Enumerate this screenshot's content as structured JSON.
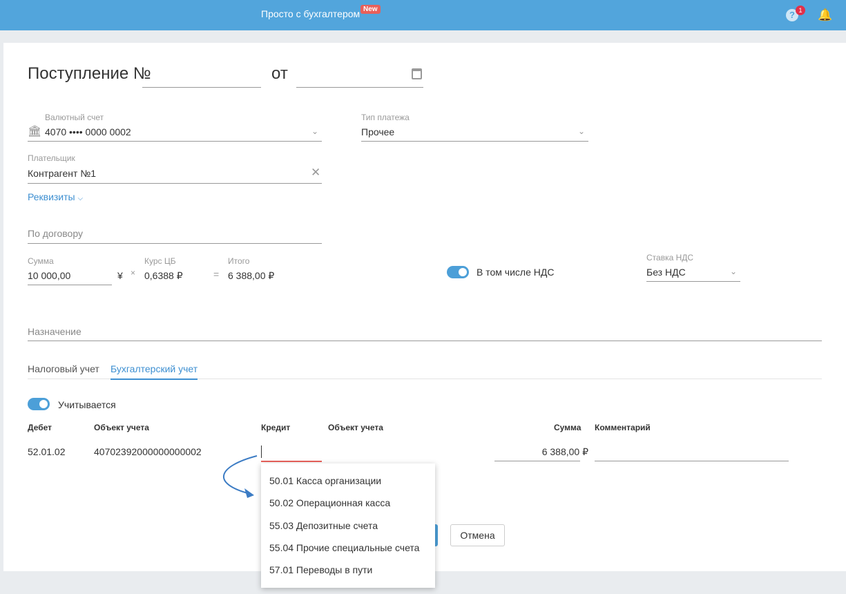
{
  "header": {
    "brand": "Просто с бухгалтером",
    "new_badge": "New",
    "help_count": "1"
  },
  "form": {
    "title": "Поступление №",
    "number_value": "",
    "from_label": "от",
    "date_value": "",
    "currency_account": {
      "label": "Валютный счет",
      "value": "4070 •••• 0000 0002"
    },
    "payment_type": {
      "label": "Тип платежа",
      "value": "Прочее"
    },
    "payer": {
      "label": "Плательщик",
      "value": "Контрагент №1"
    },
    "requisites_link": "Реквизиты",
    "contract_placeholder": "По договору",
    "amount": {
      "label": "Сумма",
      "value": "10 000,00",
      "currency": "¥"
    },
    "multiply": "×",
    "rate": {
      "label": "Курс ЦБ",
      "value": "0,6388 ₽"
    },
    "equals": "=",
    "total": {
      "label": "Итого",
      "value": "6 388,00 ₽"
    },
    "vat_included": {
      "label": "В том числе НДС",
      "on": true
    },
    "vat_rate": {
      "label": "Ставка НДС",
      "value": "Без НДС"
    },
    "purpose_placeholder": "Назначение"
  },
  "tabs": [
    {
      "label": "Налоговый учет",
      "active": false
    },
    {
      "label": "Бухгалтерский учет",
      "active": true
    }
  ],
  "accounting": {
    "toggle_label": "Учитывается",
    "columns": [
      "Дебет",
      "Объект учета",
      "Кредит",
      "Объект учета",
      "Сумма",
      "Комментарий"
    ],
    "row": {
      "debit": "52.01.02",
      "debit_object": "40702392000000000002",
      "credit": "",
      "credit_object": "",
      "amount": "6 388,00 ₽",
      "comment": ""
    }
  },
  "dropdown": [
    "50.01 Касса организации",
    "50.02 Операционная касса",
    "55.03 Депозитные счета",
    "55.04 Прочие специальные счета",
    "57.01 Переводы в пути"
  ],
  "buttons": {
    "cancel": "Отмена"
  }
}
